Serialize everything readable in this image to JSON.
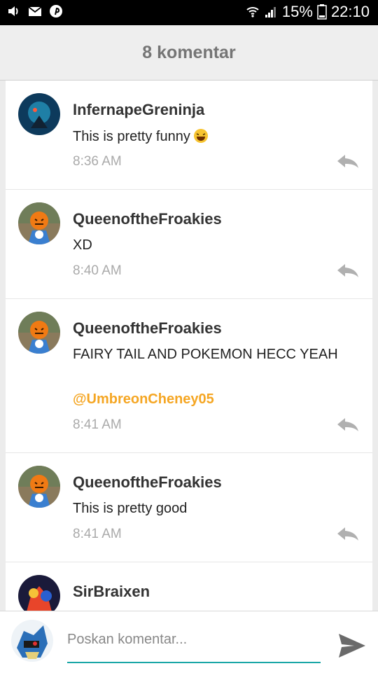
{
  "status": {
    "battery": "15%",
    "time": "22:10"
  },
  "header": {
    "title": "8 komentar"
  },
  "comments": [
    {
      "user": "InfernapeGreninja",
      "text": "This is pretty funny",
      "time": "8:36 AM"
    },
    {
      "user": "QueenoftheFroakies",
      "text": "XD",
      "time": "8:40 AM"
    },
    {
      "user": "QueenoftheFroakies",
      "text": "FAIRY TAIL AND POKEMON HECC YEAH",
      "mention": "@UmbreonCheney05",
      "time": "8:41 AM"
    },
    {
      "user": "QueenoftheFroakies",
      "text": "This is pretty good",
      "time": "8:41 AM"
    },
    {
      "user": "SirBraixen"
    }
  ],
  "composer": {
    "placeholder": "Poskan komentar..."
  },
  "icons": [
    "volume-icon",
    "mail-icon",
    "pinterest-icon",
    "wifi-icon",
    "signal-icon",
    "battery-icon",
    "reply-icon",
    "send-icon",
    "laughing-emoji-icon"
  ],
  "colors": {
    "mention": "#f5a623",
    "accent": "#1aa6a6",
    "header_text": "#757575"
  }
}
